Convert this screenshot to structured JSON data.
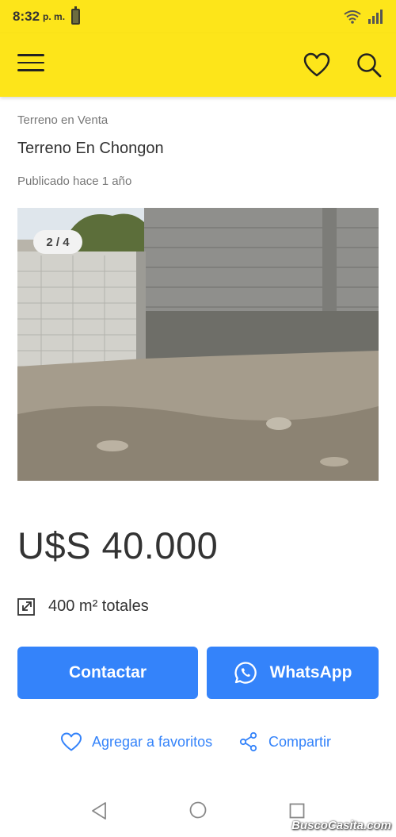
{
  "status_bar": {
    "time": "8:32",
    "ampm": "p. m."
  },
  "app_bar": {
    "menu_icon": "hamburger-menu-icon",
    "favorites_icon": "heart-icon",
    "search_icon": "search-icon",
    "background_color": "#fde51a"
  },
  "listing": {
    "category": "Terreno en Venta",
    "title": "Terreno En Chongon",
    "published": "Publicado hace 1 año",
    "photo_counter": "2 / 4",
    "price": "U$S 40.000",
    "area": "400 m² totales"
  },
  "buttons": {
    "contact_label": "Contactar",
    "whatsapp_label": "WhatsApp",
    "color": "#3483fa"
  },
  "actions": {
    "favorite_label": "Agregar a favoritos",
    "share_label": "Compartir"
  },
  "watermark": "BuscoCasita.com"
}
